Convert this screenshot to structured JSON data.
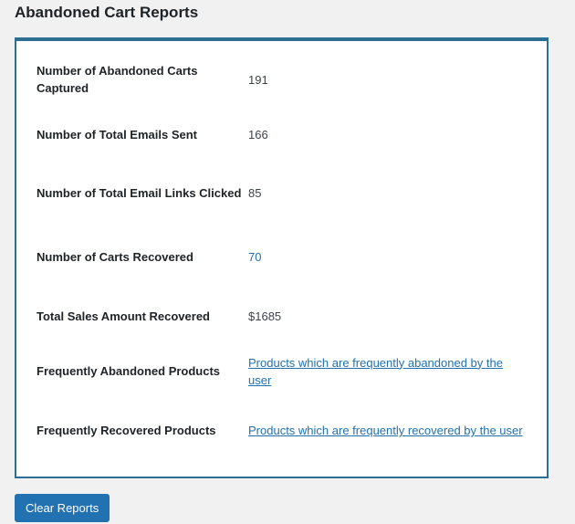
{
  "page": {
    "title": "Abandoned Cart Reports"
  },
  "report": {
    "rows": [
      {
        "label": "Number of Abandoned Carts Captured",
        "value": "191"
      },
      {
        "label": "Number of Total Emails Sent",
        "value": "166"
      },
      {
        "label": "Number of Total Email Links Clicked",
        "value": "85"
      },
      {
        "label": "Number of Carts Recovered",
        "value": "70"
      },
      {
        "label": "Total Sales Amount Recovered",
        "value": "$1685"
      },
      {
        "label": "Frequently Abandoned Products",
        "value": "Products which are frequently abandoned by the user"
      },
      {
        "label": "Frequently Recovered Products",
        "value": "Products which are frequently recovered by the user"
      }
    ]
  },
  "actions": {
    "clear_label": "Clear Reports"
  },
  "colors": {
    "accent": "#2271b1",
    "border": "#2c6f93"
  }
}
